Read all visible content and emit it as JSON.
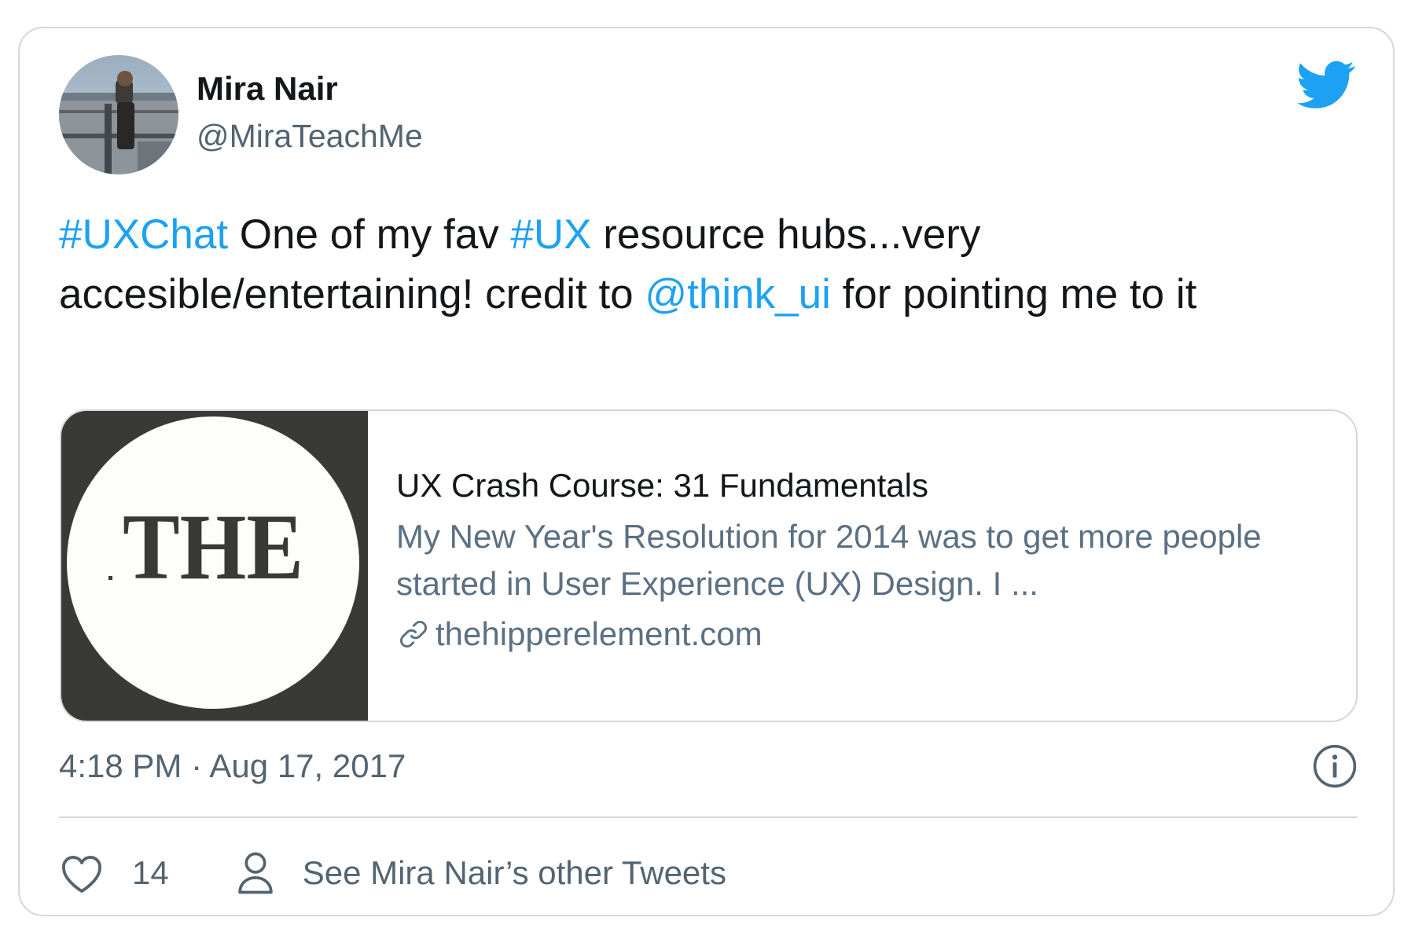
{
  "author": {
    "name": "Mira Nair",
    "handle": "@MiraTeachMe"
  },
  "tweet": {
    "segments": [
      {
        "text": "#UXChat",
        "type": "hashtag"
      },
      {
        "text": " One of my fav ",
        "type": "text"
      },
      {
        "text": "#UX",
        "type": "hashtag"
      },
      {
        "text": " resource hubs...very accesible/entertaining! credit to ",
        "type": "text"
      },
      {
        "text": "@think_ui",
        "type": "mention"
      },
      {
        "text": " for pointing me to it",
        "type": "text"
      }
    ]
  },
  "card": {
    "logo_text": "THE",
    "title": "UX Crash Course: 31 Fundamentals",
    "description": "My New Year's Resolution for 2014 was to get more people started in User Experience (UX) Design. I ...",
    "domain": "thehipperelement.com"
  },
  "meta": {
    "timestamp": "4:18 PM · Aug 17, 2017"
  },
  "actions": {
    "like_count": "14",
    "other_tweets_label": "See Mira Nair’s other Tweets"
  },
  "icons": {
    "brand": "twitter-bird-icon",
    "info": "info-icon",
    "like": "heart-icon",
    "profile": "person-icon",
    "link": "link-icon"
  },
  "colors": {
    "brand": "#1da1f2",
    "text": "#14171a",
    "secondary": "#536471",
    "border": "#cfd9de",
    "card_thumb_bg": "#393a35"
  }
}
